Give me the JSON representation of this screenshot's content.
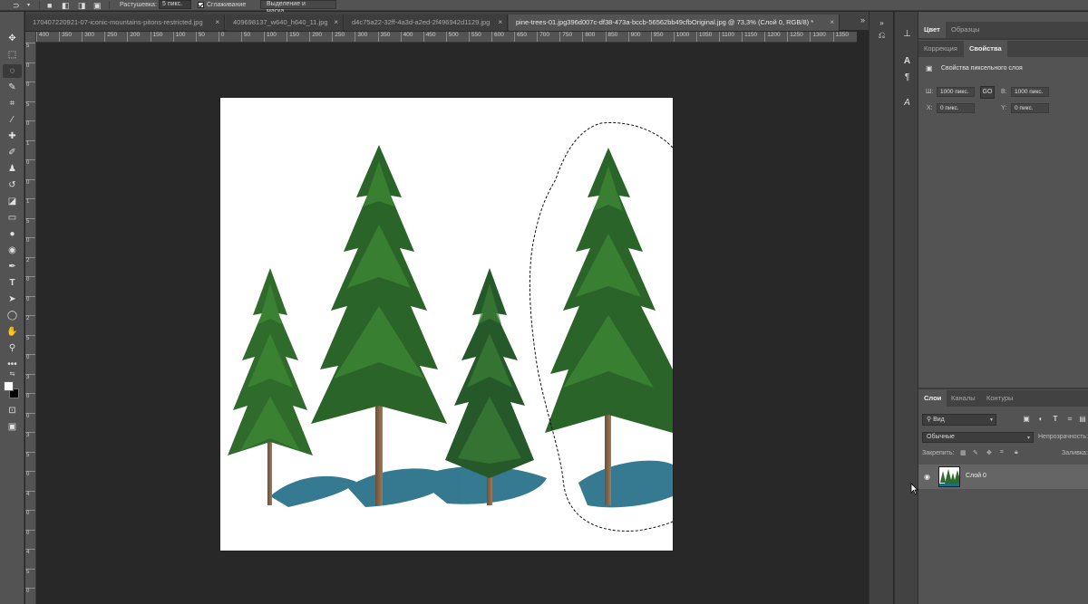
{
  "options_bar": {
    "feather_label": "Растушевка:",
    "feather_value": "5 пикс.",
    "antialias_label": "Сглаживание",
    "select_mask_button": "Выделение и маска..."
  },
  "tabs": [
    {
      "label": "170407220921-07-iconic-mountains-pitons-restricted.jpg",
      "close": "×"
    },
    {
      "label": "409698137_w640_h640_11.jpg",
      "close": "×"
    },
    {
      "label": "d4c75a22-32ff-4a3d-a2ed-2f496942d1129.jpg",
      "close": "×"
    },
    {
      "label": "pine-trees-01.jpg396d007c-df38-473a-bccb-56562bb49cfbOriginal.jpg @ 73,3% (Слой 0, RGB/8) *",
      "close": "×"
    }
  ],
  "tabs_overflow": "»",
  "ruler": {
    "h_ticks": [
      "400",
      "350",
      "300",
      "250",
      "200",
      "150",
      "100",
      "50",
      "0",
      "50",
      "100",
      "150",
      "200",
      "250",
      "300",
      "350",
      "400",
      "450",
      "500",
      "550",
      "600",
      "650",
      "700",
      "750",
      "800",
      "850",
      "900",
      "950",
      "1000",
      "1050",
      "1100",
      "1150",
      "1200",
      "1250",
      "1300",
      "1350"
    ],
    "v_ticks": [
      "5",
      "0",
      "0",
      "5",
      "0",
      "1",
      "0",
      "0",
      "1",
      "5",
      "0",
      "2",
      "0",
      "0",
      "2",
      "5",
      "0",
      "3",
      "0",
      "0",
      "3",
      "5",
      "0",
      "4",
      "0",
      "0",
      "4",
      "5",
      "0"
    ]
  },
  "tools": [
    "move-icon",
    "marquee-icon",
    "lasso-icon",
    "quick-select-icon",
    "crop-icon",
    "eyedropper-icon",
    "healing-icon",
    "brush-icon",
    "stamp-icon",
    "history-brush-icon",
    "eraser-icon",
    "gradient-icon",
    "blur-icon",
    "dodge-icon",
    "pen-icon",
    "type-icon",
    "path-select-icon",
    "ellipse-icon",
    "hand-icon",
    "zoom-icon",
    "more-icon"
  ],
  "colors": {
    "foreground": "#ffffff",
    "background": "#000000",
    "ui_dark": "#282828",
    "ui_panel": "#535353",
    "tree_green": "#2f6b2b",
    "shadow_teal": "#1f6b84"
  },
  "panels": {
    "top_tabs": [
      "Цвет",
      "Образцы"
    ],
    "sub_tabs": [
      "Коррекция",
      "Свойства"
    ],
    "properties_title": "Свойства пиксельного слоя",
    "width_label": "Ш:",
    "width_value": "1000 пикс.",
    "link_symbol": "GO",
    "height_label": "В:",
    "height_value": "1000 пикс.",
    "x_label": "X:",
    "x_value": "0 пикс.",
    "y_label": "Y:",
    "y_value": "0 пикс.",
    "layers_tabs": [
      "Слои",
      "Каналы",
      "Контуры"
    ],
    "kind_filter": "Вид",
    "blend_mode": "Обычные",
    "opacity_label": "Непрозрачность:",
    "lock_label": "Закрепить:",
    "fill_label": "Заливка:",
    "layer_name": "Слой 0"
  }
}
